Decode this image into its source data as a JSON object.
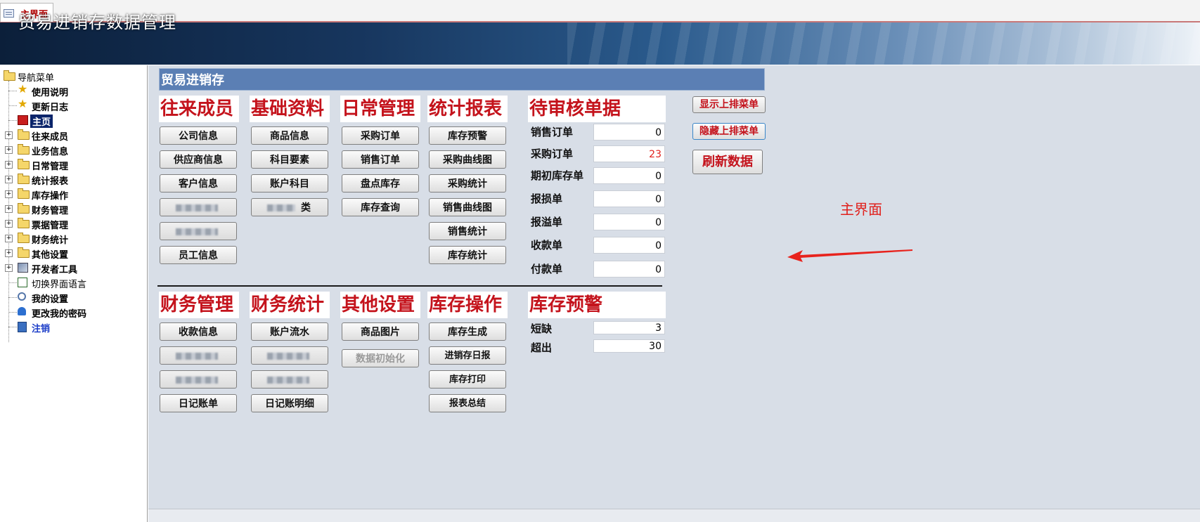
{
  "window": {
    "tab_label": "主界面"
  },
  "app": {
    "title": "贸易进销存数据管理"
  },
  "nav": {
    "root": "导航菜单",
    "items": [
      {
        "label": "使用说明",
        "icon": "star-icon"
      },
      {
        "label": "更新日志",
        "icon": "star-icon"
      },
      {
        "label": "主页",
        "icon": "home-icon"
      },
      {
        "label": "往来成员",
        "icon": "folder-icon"
      },
      {
        "label": "业务信息",
        "icon": "folder-icon"
      },
      {
        "label": "日常管理",
        "icon": "folder-icon"
      },
      {
        "label": "统计报表",
        "icon": "folder-icon"
      },
      {
        "label": "库存操作",
        "icon": "folder-icon"
      },
      {
        "label": "财务管理",
        "icon": "folder-icon"
      },
      {
        "label": "票据管理",
        "icon": "folder-icon"
      },
      {
        "label": "财务统计",
        "icon": "folder-icon"
      },
      {
        "label": "其他设置",
        "icon": "folder-icon"
      },
      {
        "label": "开发者工具",
        "icon": "tools-icon"
      },
      {
        "label": "切换界面语言",
        "icon": "chart-icon"
      },
      {
        "label": "我的设置",
        "icon": "settings-icon"
      },
      {
        "label": "更改我的密码",
        "icon": "user-key-icon"
      },
      {
        "label": "注销",
        "icon": "logout-icon"
      }
    ]
  },
  "panel": {
    "title": "贸易进销存"
  },
  "groups": {
    "wanglai": {
      "title": "往来成员",
      "buttons": [
        "公司信息",
        "供应商信息",
        "客户信息",
        "",
        "",
        "员工信息"
      ]
    },
    "jichu": {
      "title": "基础资料",
      "buttons": [
        "商品信息",
        "科目要素",
        "账户科目",
        "类"
      ]
    },
    "richang": {
      "title": "日常管理",
      "buttons": [
        "采购订单",
        "销售订单",
        "盘点库存",
        "库存查询"
      ]
    },
    "tongji": {
      "title": "统计报表",
      "buttons": [
        "库存预警",
        "采购曲线图",
        "采购统计",
        "销售曲线图",
        "销售统计",
        "库存统计"
      ]
    },
    "caiwu": {
      "title": "财务管理",
      "buttons": [
        "收款信息",
        "",
        "",
        "日记账单"
      ]
    },
    "caiwutongji": {
      "title": "财务统计",
      "buttons": [
        "账户流水",
        "",
        "",
        "日记账明细"
      ]
    },
    "qita": {
      "title": "其他设置",
      "buttons": [
        "商品图片",
        "数据初始化"
      ]
    },
    "kucun": {
      "title": "库存操作",
      "buttons": [
        "库存生成",
        "进销存日报",
        "库存打印",
        "报表总结"
      ]
    }
  },
  "pending": {
    "title": "待审核单据",
    "rows": [
      {
        "label": "销售订单",
        "value": "0"
      },
      {
        "label": "采购订单",
        "value": "23"
      },
      {
        "label": "期初库存单",
        "value": "0"
      },
      {
        "label": "报损单",
        "value": "0"
      },
      {
        "label": "报溢单",
        "value": "0"
      },
      {
        "label": "收款单",
        "value": "0"
      },
      {
        "label": "付款单",
        "value": "0"
      }
    ]
  },
  "warning": {
    "title": "库存预警",
    "rows": [
      {
        "label": "短缺",
        "value": "3"
      },
      {
        "label": "超出",
        "value": "30"
      }
    ]
  },
  "side_buttons": {
    "show": "显示上排菜单",
    "hide": "隐藏上排菜单",
    "refresh": "刷新数据"
  },
  "annotation": {
    "text": "主界面",
    "color": "#e0201c"
  },
  "colors": {
    "group_title": "#c4131c",
    "panel_header": "#5b7fb4",
    "nav_selected": "#0a246a"
  }
}
